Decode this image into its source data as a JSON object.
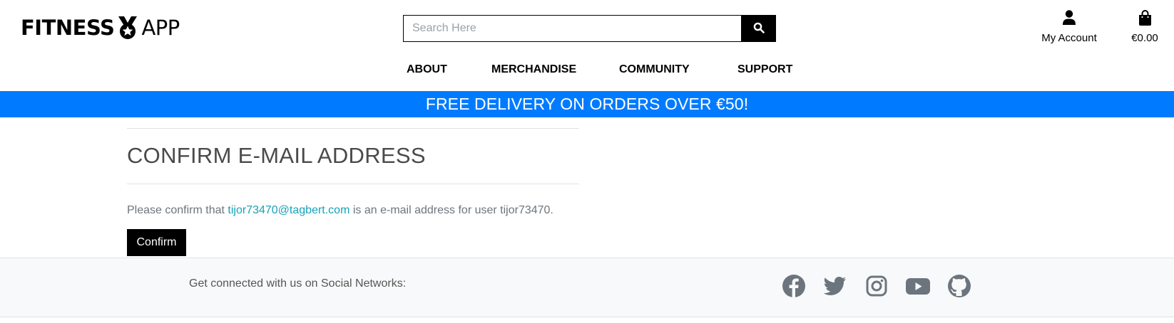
{
  "header": {
    "logo": {
      "part1": "FITNESS",
      "part2": "APP"
    },
    "search": {
      "placeholder": "Search Here",
      "value": ""
    },
    "account": {
      "label": "My Account",
      "icon": "user-icon"
    },
    "cart": {
      "total": "€0.00",
      "icon": "shopping-bag-icon"
    }
  },
  "nav": {
    "items": [
      {
        "label": "ABOUT"
      },
      {
        "label": "MERCHANDISE"
      },
      {
        "label": "COMMUNITY"
      },
      {
        "label": "SUPPORT"
      }
    ]
  },
  "banner": {
    "text": "FREE DELIVERY ON ORDERS OVER €50!",
    "color": "#007bff"
  },
  "main": {
    "title": "CONFIRM E-MAIL ADDRESS",
    "message": {
      "prefix": "Please confirm that ",
      "email": "tijor73470@tagbert.com",
      "suffix": " is an e-mail address for user tijor73470."
    },
    "confirm_label": "Confirm"
  },
  "footer": {
    "social_text": "Get connected with us on Social Networks:",
    "icons": [
      "facebook-icon",
      "twitter-icon",
      "instagram-icon",
      "youtube-icon",
      "github-icon"
    ]
  }
}
